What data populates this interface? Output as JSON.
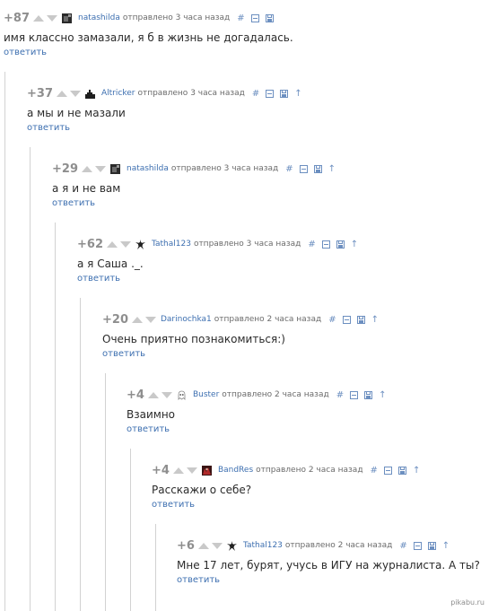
{
  "comments": [
    {
      "score": "+87",
      "user": "natashilda",
      "sent": "отправлено",
      "time": "3 часа назад",
      "hash": "#",
      "parent": "",
      "text": "имя классно замазали, я б в жизнь не догадалась.",
      "reply": "ответить",
      "avatar": "dark-photo"
    },
    {
      "score": "+37",
      "user": "Altricker",
      "sent": "отправлено",
      "time": "3 часа назад",
      "hash": "#",
      "parent": "↑",
      "text": "а мы и не мазали",
      "reply": "ответить",
      "avatar": "castle"
    },
    {
      "score": "+29",
      "user": "natashilda",
      "sent": "отправлено",
      "time": "3 часа назад",
      "hash": "#",
      "parent": "↑",
      "text": "а я и не вам",
      "reply": "ответить",
      "avatar": "dark-photo"
    },
    {
      "score": "+62",
      "user": "Tathal123",
      "sent": "отправлено",
      "time": "3 часа назад",
      "hash": "#",
      "parent": "↑",
      "text": "а я Саша ._.",
      "reply": "ответить",
      "avatar": "splat"
    },
    {
      "score": "+20",
      "user": "Darinochka1",
      "sent": "отправлено",
      "time": "2 часа назад",
      "hash": "#",
      "parent": "↑",
      "text": "Очень приятно познакомиться:)",
      "reply": "ответить",
      "avatar": "none"
    },
    {
      "score": "+4",
      "user": "Buster",
      "sent": "отправлено",
      "time": "2 часа назад",
      "hash": "#",
      "parent": "↑",
      "text": "Взаимно",
      "reply": "ответить",
      "avatar": "ghost"
    },
    {
      "score": "+4",
      "user": "BandRes",
      "sent": "отправлено",
      "time": "2 часа назад",
      "hash": "#",
      "parent": "↑",
      "text": "Расскажи о себе?",
      "reply": "ответить",
      "avatar": "red-photo"
    },
    {
      "score": "+6",
      "user": "Tathal123",
      "sent": "отправлено",
      "time": "2 часа назад",
      "hash": "#",
      "parent": "↑",
      "text": "Мне 17 лет, бурят, учусь в ИГУ на журналиста. А ты?",
      "reply": "ответить",
      "avatar": "splat"
    }
  ],
  "watermark": "pikabu.ru",
  "colors": {
    "username": "#3d6fb0",
    "score": "#8e8e8e",
    "vote_arrow": "#c9c9c9",
    "tree_line": "#d2d2d2"
  }
}
